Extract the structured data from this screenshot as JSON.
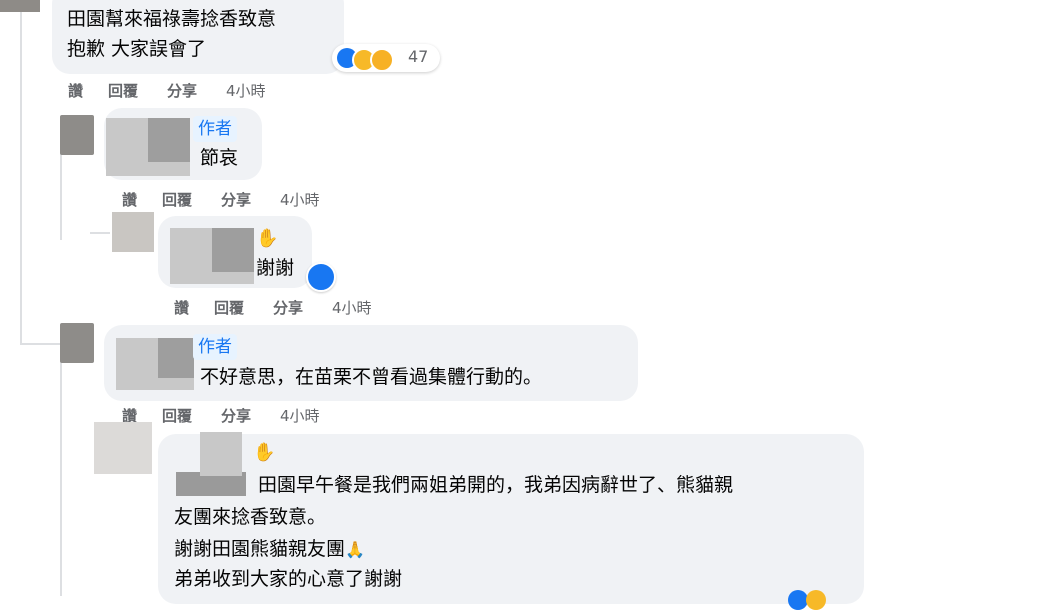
{
  "comments": [
    {
      "text_lines": [
        "田園幫來福祿壽捻香致意",
        "抱歉 大家誤會了"
      ],
      "reactions": {
        "count": "47",
        "icons": [
          "like-icon",
          "care-icon",
          "sad-icon"
        ]
      },
      "actions": {
        "like": "讚",
        "reply": "回覆",
        "share": "分享",
        "time": "4小時"
      }
    },
    {
      "badge": "作者",
      "text_lines": [
        "節哀"
      ],
      "actions": {
        "like": "讚",
        "reply": "回覆",
        "share": "分享",
        "time": "4小時"
      }
    },
    {
      "text_lines": [
        "謝謝"
      ],
      "reactions": {
        "icons": [
          "like-icon"
        ]
      },
      "actions": {
        "like": "讚",
        "reply": "回覆",
        "share": "分享",
        "time": "4小時"
      }
    },
    {
      "badge": "作者",
      "text_lines": [
        "不好意思，在苗栗不曾看過集體行動的。"
      ],
      "actions": {
        "like": "讚",
        "reply": "回覆",
        "share": "分享",
        "time": "4小時"
      }
    },
    {
      "text_lines": [
        "田園早午餐是我們兩姐弟開的，我弟因病辭世了、熊貓親",
        "友團來捻香致意。",
        "謝謝田園熊貓親友團",
        "弟弟收到大家的心意了謝謝"
      ],
      "emoji": {
        "pray": "🙏"
      }
    }
  ],
  "colors": {
    "bubble": "#f0f2f5",
    "muted": "#65676b",
    "accent": "#1877f2",
    "badge_bg": "#e7f3ff"
  }
}
